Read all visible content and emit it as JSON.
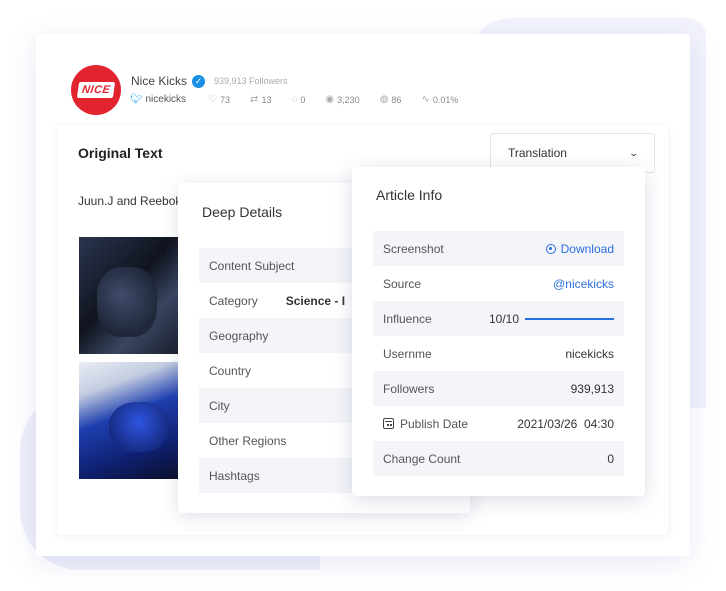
{
  "profile": {
    "name": "Nice Kicks",
    "avatar_text": "NICE",
    "followers_text": "939,913 Followers",
    "handle": "nicekicks",
    "stats": [
      {
        "icon": "heart-icon",
        "glyph": "♡",
        "value": "73"
      },
      {
        "icon": "retweet-icon",
        "glyph": "⇄",
        "value": "13"
      },
      {
        "icon": "comment-icon",
        "glyph": "◌",
        "value": "0"
      },
      {
        "icon": "eye-icon",
        "glyph": "◉",
        "value": "3,230"
      },
      {
        "icon": "chat-icon",
        "glyph": "◍",
        "value": "86"
      },
      {
        "icon": "activity-icon",
        "glyph": "∿",
        "value": "0.01%"
      }
    ]
  },
  "original": {
    "title": "Original Text",
    "text": "Juun.J and Reebok"
  },
  "translation": {
    "selected": "Translation"
  },
  "deep_details": {
    "title": "Deep Details",
    "rows": [
      {
        "label": "Content Subject",
        "value": ""
      },
      {
        "label": "Category",
        "value": "Science - I"
      },
      {
        "label": "Geography",
        "value": ""
      },
      {
        "label": "Country",
        "value": ""
      },
      {
        "label": "City",
        "value": ""
      },
      {
        "label": "Other Regions",
        "value": ""
      },
      {
        "label": "Hashtags",
        "value": ""
      }
    ]
  },
  "article_info": {
    "title": "Article Info",
    "screenshot_label": "Screenshot",
    "download_label": "Download",
    "source_label": "Source",
    "source_value": "@nicekicks",
    "influence_label": "Influence",
    "influence_value": "10/10",
    "influence_fraction": 1.0,
    "username_label": "Usernme",
    "username_value": "nicekicks",
    "followers_label": "Followers",
    "followers_value": "939,913",
    "publish_label": "Publish Date",
    "publish_value": "2021/03/26  04:30",
    "change_label": "Change Count",
    "change_value": "0"
  },
  "colors": {
    "accent": "#2a6fe0",
    "brand_red": "#e2242f",
    "twitter_blue": "#1da1f2"
  }
}
